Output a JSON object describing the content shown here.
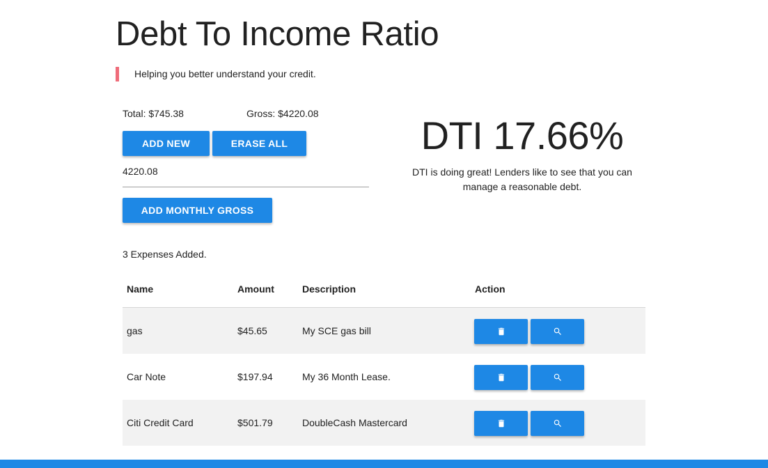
{
  "header": {
    "title": "Debt To Income Ratio",
    "subtitle": "Helping you better understand your credit."
  },
  "summary": {
    "total": "Total: $745.38",
    "gross": "Gross: $4220.08"
  },
  "buttons": {
    "add_new": "ADD NEW",
    "erase_all": "ERASE ALL",
    "add_monthly_gross": "ADD MONTHLY GROSS"
  },
  "gross_input": {
    "value": "4220.08"
  },
  "dti": {
    "value": "DTI 17.66%",
    "message": "DTI is doing great! Lenders like to see that you can manage a reasonable debt."
  },
  "expenses": {
    "count_text": "3 Expenses Added.",
    "columns": [
      "Name",
      "Amount",
      "Description",
      "Action"
    ],
    "rows": [
      {
        "name": "gas",
        "amount": "$45.65",
        "description": "My SCE gas bill"
      },
      {
        "name": "Car Note",
        "amount": "$197.94",
        "description": "My 36 Month Lease."
      },
      {
        "name": "Citi Credit Card",
        "amount": "$501.79",
        "description": "DoubleCash Mastercard"
      }
    ]
  },
  "icons": {
    "delete": "trash-icon",
    "view": "search-icon"
  },
  "colors": {
    "primary": "#1e88e5",
    "quote_accent": "#ef6c7a",
    "row_stripe": "#f2f2f2"
  }
}
